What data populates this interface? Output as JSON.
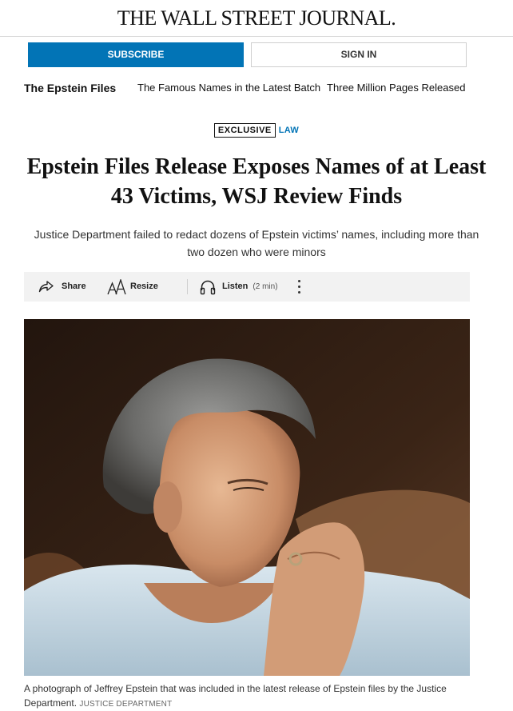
{
  "masthead": {
    "logo_text": "THE WALL STREET JOURNAL."
  },
  "account": {
    "subscribe_label": "SUBSCRIBE",
    "signin_label": "SIGN IN"
  },
  "subnav": {
    "home": "The Epstein Files",
    "links": [
      "The Famous Names in the Latest Batch",
      "Three Million Pages Released"
    ]
  },
  "article": {
    "flag": "EXCLUSIVE",
    "section": "LAW",
    "headline": "Epstein Files Release Exposes Names of at Least 43 Victims, WSJ Review Finds",
    "dek": "Justice Department failed to redact dozens of Epstein victims’ names, including more than two dozen who were minors"
  },
  "toolbar": {
    "share_label": "Share",
    "resize_label": "Resize",
    "listen_label": "Listen",
    "listen_duration": "(2 min)",
    "icons": [
      "share-icon",
      "resize-icon",
      "headphones-icon",
      "more-vertical-icon"
    ]
  },
  "media": {
    "caption": "A photograph of Jeffrey Epstein that was included in the latest release of Epstein files by the Justice Department.",
    "credit": "JUSTICE DEPARTMENT"
  },
  "colors": {
    "accent": "#0274b6",
    "toolbar_bg": "#f2f2f2",
    "text": "#111111"
  }
}
